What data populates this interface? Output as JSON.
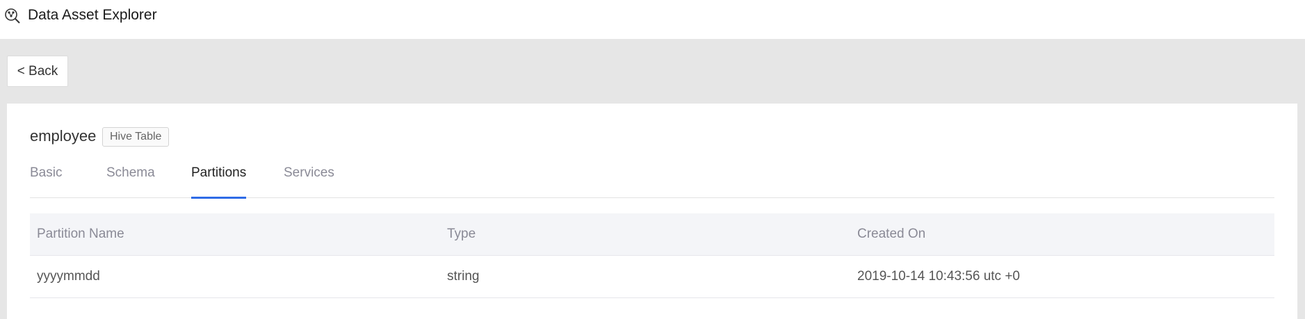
{
  "app": {
    "title": "Data Asset Explorer",
    "icon": "explorer-logo-icon"
  },
  "nav": {
    "back_label": "< Back"
  },
  "asset": {
    "name": "employee",
    "badge": "Hive Table"
  },
  "tabs": [
    {
      "label": "Basic",
      "active": false
    },
    {
      "label": "Schema",
      "active": false
    },
    {
      "label": "Partitions",
      "active": true
    },
    {
      "label": "Services",
      "active": false
    }
  ],
  "partitions_table": {
    "columns": [
      "Partition Name",
      "Type",
      "Created On"
    ],
    "rows": [
      [
        "yyyymmdd",
        "string",
        "2019-10-14 10:43:56 utc +0"
      ]
    ]
  },
  "colors": {
    "accent": "#2e6be6",
    "page_bg": "#e6e6e6",
    "header_row_bg": "#f4f5f8"
  }
}
